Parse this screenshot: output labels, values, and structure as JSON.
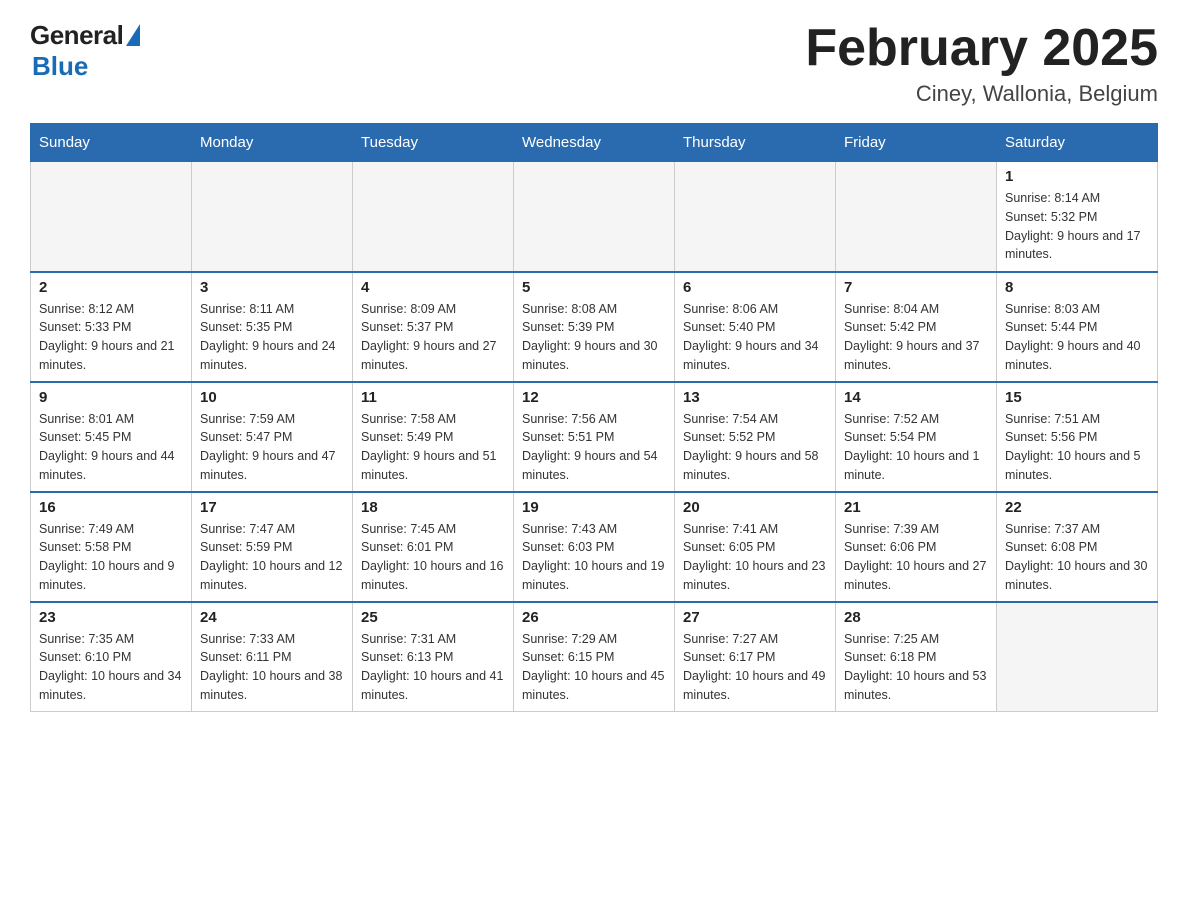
{
  "header": {
    "logo_general": "General",
    "logo_blue": "Blue",
    "month_year": "February 2025",
    "location": "Ciney, Wallonia, Belgium"
  },
  "weekdays": [
    "Sunday",
    "Monday",
    "Tuesday",
    "Wednesday",
    "Thursday",
    "Friday",
    "Saturday"
  ],
  "weeks": [
    [
      {
        "day": "",
        "info": "",
        "empty": true
      },
      {
        "day": "",
        "info": "",
        "empty": true
      },
      {
        "day": "",
        "info": "",
        "empty": true
      },
      {
        "day": "",
        "info": "",
        "empty": true
      },
      {
        "day": "",
        "info": "",
        "empty": true
      },
      {
        "day": "",
        "info": "",
        "empty": true
      },
      {
        "day": "1",
        "info": "Sunrise: 8:14 AM\nSunset: 5:32 PM\nDaylight: 9 hours and 17 minutes.",
        "empty": false
      }
    ],
    [
      {
        "day": "2",
        "info": "Sunrise: 8:12 AM\nSunset: 5:33 PM\nDaylight: 9 hours and 21 minutes.",
        "empty": false
      },
      {
        "day": "3",
        "info": "Sunrise: 8:11 AM\nSunset: 5:35 PM\nDaylight: 9 hours and 24 minutes.",
        "empty": false
      },
      {
        "day": "4",
        "info": "Sunrise: 8:09 AM\nSunset: 5:37 PM\nDaylight: 9 hours and 27 minutes.",
        "empty": false
      },
      {
        "day": "5",
        "info": "Sunrise: 8:08 AM\nSunset: 5:39 PM\nDaylight: 9 hours and 30 minutes.",
        "empty": false
      },
      {
        "day": "6",
        "info": "Sunrise: 8:06 AM\nSunset: 5:40 PM\nDaylight: 9 hours and 34 minutes.",
        "empty": false
      },
      {
        "day": "7",
        "info": "Sunrise: 8:04 AM\nSunset: 5:42 PM\nDaylight: 9 hours and 37 minutes.",
        "empty": false
      },
      {
        "day": "8",
        "info": "Sunrise: 8:03 AM\nSunset: 5:44 PM\nDaylight: 9 hours and 40 minutes.",
        "empty": false
      }
    ],
    [
      {
        "day": "9",
        "info": "Sunrise: 8:01 AM\nSunset: 5:45 PM\nDaylight: 9 hours and 44 minutes.",
        "empty": false
      },
      {
        "day": "10",
        "info": "Sunrise: 7:59 AM\nSunset: 5:47 PM\nDaylight: 9 hours and 47 minutes.",
        "empty": false
      },
      {
        "day": "11",
        "info": "Sunrise: 7:58 AM\nSunset: 5:49 PM\nDaylight: 9 hours and 51 minutes.",
        "empty": false
      },
      {
        "day": "12",
        "info": "Sunrise: 7:56 AM\nSunset: 5:51 PM\nDaylight: 9 hours and 54 minutes.",
        "empty": false
      },
      {
        "day": "13",
        "info": "Sunrise: 7:54 AM\nSunset: 5:52 PM\nDaylight: 9 hours and 58 minutes.",
        "empty": false
      },
      {
        "day": "14",
        "info": "Sunrise: 7:52 AM\nSunset: 5:54 PM\nDaylight: 10 hours and 1 minute.",
        "empty": false
      },
      {
        "day": "15",
        "info": "Sunrise: 7:51 AM\nSunset: 5:56 PM\nDaylight: 10 hours and 5 minutes.",
        "empty": false
      }
    ],
    [
      {
        "day": "16",
        "info": "Sunrise: 7:49 AM\nSunset: 5:58 PM\nDaylight: 10 hours and 9 minutes.",
        "empty": false
      },
      {
        "day": "17",
        "info": "Sunrise: 7:47 AM\nSunset: 5:59 PM\nDaylight: 10 hours and 12 minutes.",
        "empty": false
      },
      {
        "day": "18",
        "info": "Sunrise: 7:45 AM\nSunset: 6:01 PM\nDaylight: 10 hours and 16 minutes.",
        "empty": false
      },
      {
        "day": "19",
        "info": "Sunrise: 7:43 AM\nSunset: 6:03 PM\nDaylight: 10 hours and 19 minutes.",
        "empty": false
      },
      {
        "day": "20",
        "info": "Sunrise: 7:41 AM\nSunset: 6:05 PM\nDaylight: 10 hours and 23 minutes.",
        "empty": false
      },
      {
        "day": "21",
        "info": "Sunrise: 7:39 AM\nSunset: 6:06 PM\nDaylight: 10 hours and 27 minutes.",
        "empty": false
      },
      {
        "day": "22",
        "info": "Sunrise: 7:37 AM\nSunset: 6:08 PM\nDaylight: 10 hours and 30 minutes.",
        "empty": false
      }
    ],
    [
      {
        "day": "23",
        "info": "Sunrise: 7:35 AM\nSunset: 6:10 PM\nDaylight: 10 hours and 34 minutes.",
        "empty": false
      },
      {
        "day": "24",
        "info": "Sunrise: 7:33 AM\nSunset: 6:11 PM\nDaylight: 10 hours and 38 minutes.",
        "empty": false
      },
      {
        "day": "25",
        "info": "Sunrise: 7:31 AM\nSunset: 6:13 PM\nDaylight: 10 hours and 41 minutes.",
        "empty": false
      },
      {
        "day": "26",
        "info": "Sunrise: 7:29 AM\nSunset: 6:15 PM\nDaylight: 10 hours and 45 minutes.",
        "empty": false
      },
      {
        "day": "27",
        "info": "Sunrise: 7:27 AM\nSunset: 6:17 PM\nDaylight: 10 hours and 49 minutes.",
        "empty": false
      },
      {
        "day": "28",
        "info": "Sunrise: 7:25 AM\nSunset: 6:18 PM\nDaylight: 10 hours and 53 minutes.",
        "empty": false
      },
      {
        "day": "",
        "info": "",
        "empty": true
      }
    ]
  ]
}
